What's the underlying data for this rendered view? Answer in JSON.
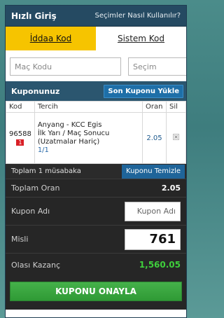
{
  "header": {
    "title": "Hızlı Giriş",
    "help_link": "Seçimler Nasıl Kullanılır?"
  },
  "tabs": [
    {
      "label": "İddaa Kod",
      "active": true
    },
    {
      "label": "Sistem Kod",
      "active": false
    }
  ],
  "inputs": {
    "match_code_placeholder": "Maç Kodu",
    "selection_placeholder": "Seçim"
  },
  "coupon": {
    "title": "Kuponunuz",
    "load_last_label": "Son Kuponu Yükle",
    "columns": [
      "Kod",
      "Tercih",
      "Oran",
      "Sil"
    ],
    "rows": [
      {
        "code": "96588",
        "mbs": "1",
        "match": "Anyang - KCC Egis",
        "market": "İlk Yarı / Maç Sonucu",
        "market_note": "(Uzatmalar Hariç)",
        "pick": "1/1",
        "odd": "2.05",
        "delete_icon": "close-icon"
      }
    ],
    "summary_label": "Toplam 1 müsabaka",
    "clear_label": "Kuponu Temizle"
  },
  "totals": {
    "total_odds_label": "Toplam Oran",
    "total_odds_value": "2.05",
    "coupon_name_label": "Kupon Adı",
    "coupon_name_placeholder": "Kupon Adı",
    "stake_label": "Misli",
    "stake_value": "761",
    "winnings_label": "Olası Kazanç",
    "winnings_value": "1,560.05",
    "confirm_label": "KUPONU ONAYLA"
  },
  "colors": {
    "accent_yellow": "#f6c400",
    "header_blue": "#254a62",
    "winnings_green": "#3fcf3c",
    "confirm_green": "#3ba540",
    "mbs_red": "#d91f26"
  }
}
